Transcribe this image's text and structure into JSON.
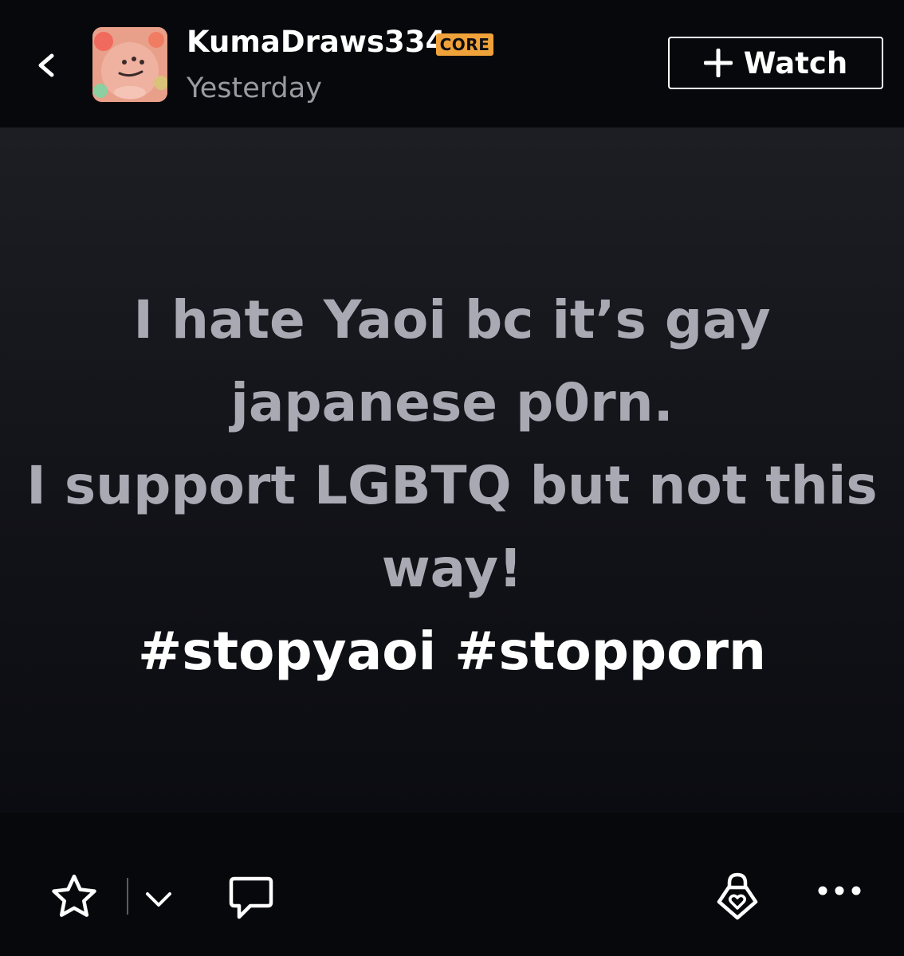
{
  "header": {
    "username": "KumaDraws334",
    "badge": "CORE",
    "timestamp": "Yesterday",
    "watch_label": "Watch",
    "back_icon": "chevron-left-icon",
    "watch_icon": "plus-icon"
  },
  "post": {
    "lines": [
      "I hate Yaoi bc it’s gay",
      "japanese p0rn.",
      "I support LGBTQ but not this",
      "way!"
    ],
    "hashtags": "#stopyaoi #stopporn"
  },
  "actions": {
    "favourite_icon": "star-icon",
    "expand_icon": "chevron-down-icon",
    "comment_icon": "speech-bubble-icon",
    "gift_icon": "heart-lock-icon",
    "more_icon": "more-icon"
  },
  "colors": {
    "background": "#0d0e13",
    "badge": "#f0a23a",
    "post_text": "#a9a9b3",
    "hashtag_text": "#ffffff"
  }
}
